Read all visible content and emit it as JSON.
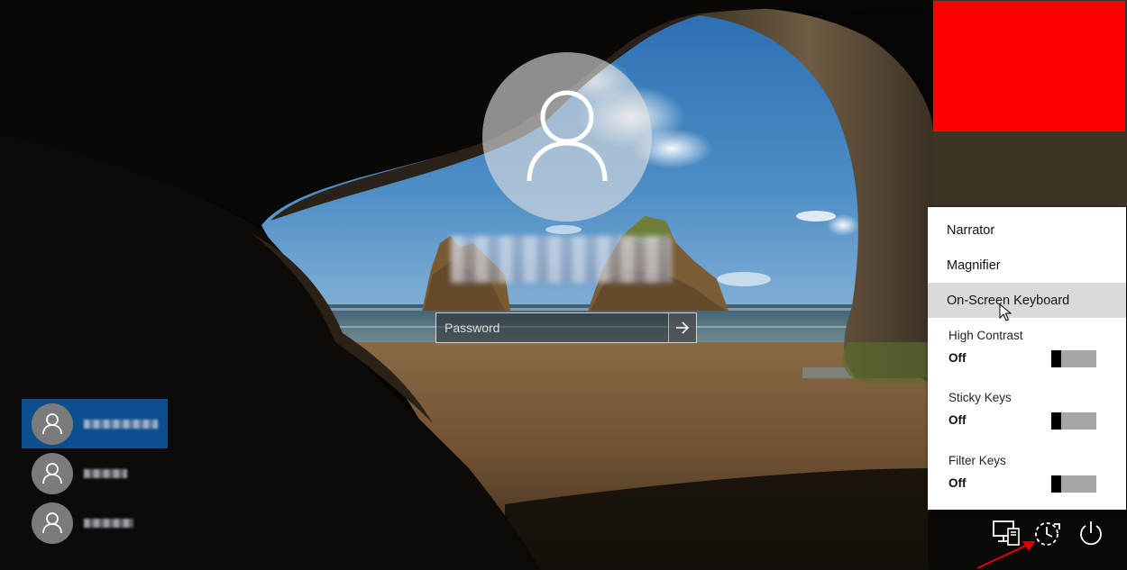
{
  "login": {
    "password_placeholder": "Password"
  },
  "users": [
    {
      "selected": true
    },
    {
      "selected": false
    },
    {
      "selected": false
    }
  ],
  "access_menu": {
    "items": [
      {
        "label": "Narrator"
      },
      {
        "label": "Magnifier"
      },
      {
        "label": "On-Screen Keyboard"
      }
    ],
    "toggles": [
      {
        "label": "High Contrast",
        "state": "Off"
      },
      {
        "label": "Sticky Keys",
        "state": "Off"
      },
      {
        "label": "Filter Keys",
        "state": "Off"
      }
    ]
  },
  "tray": {
    "icons": [
      "network-icon",
      "ease-of-access-icon",
      "power-icon"
    ]
  },
  "colors": {
    "selection": "#0b4f91",
    "redaction": "#ff0000",
    "annotation_arrow": "#e00000"
  }
}
